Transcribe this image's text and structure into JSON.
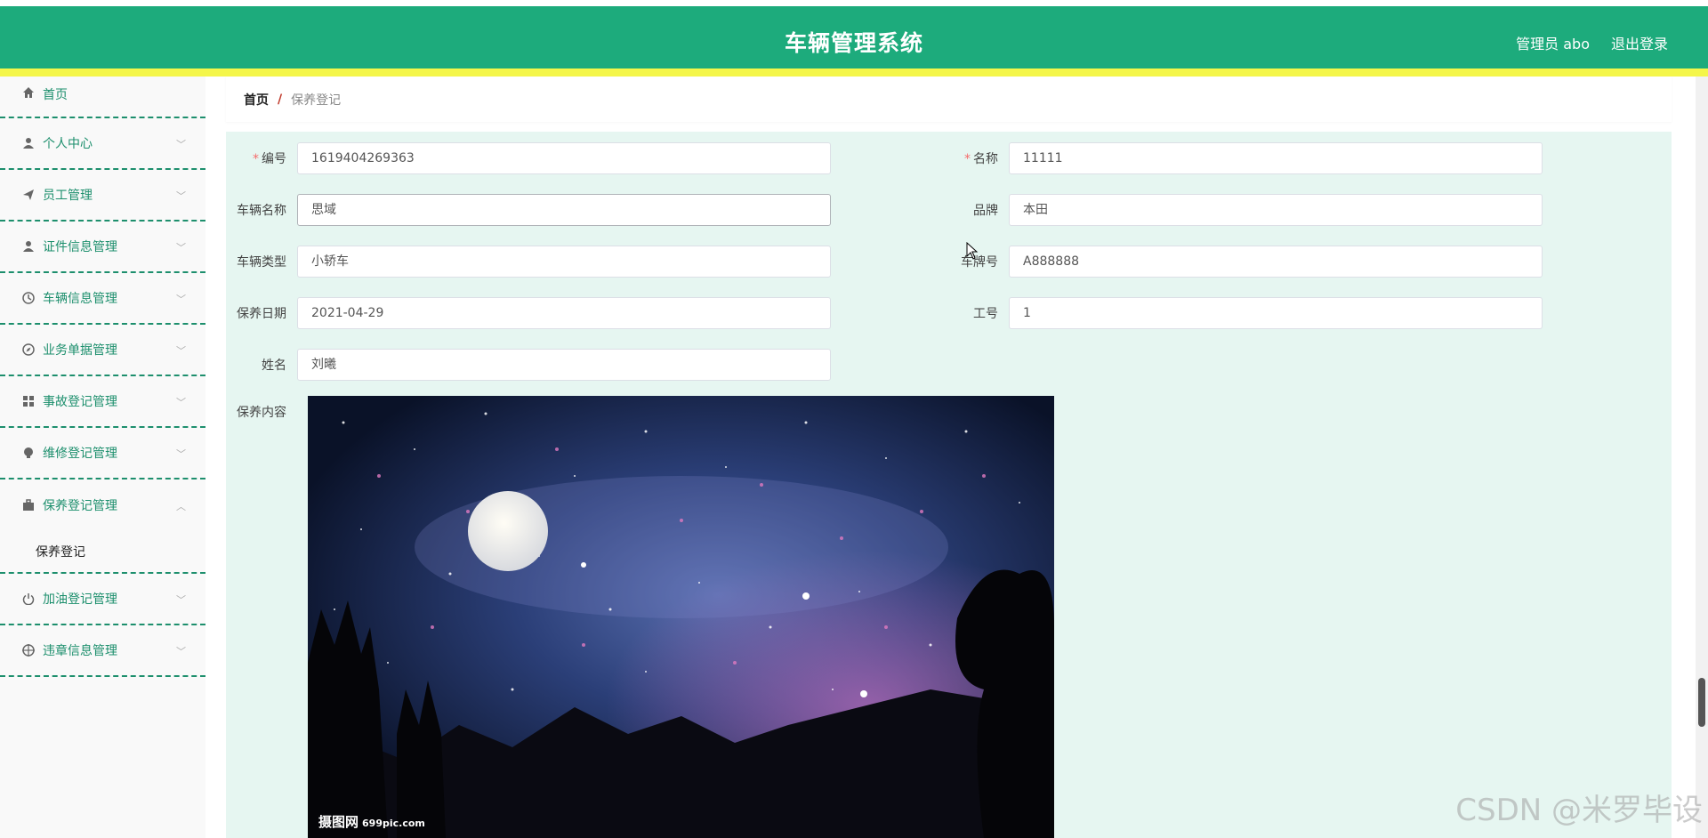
{
  "header": {
    "title": "车辆管理系统",
    "user": "管理员 abo",
    "logout": "退出登录"
  },
  "sidebar": {
    "items": [
      {
        "label": "首页",
        "icon": "home-icon"
      },
      {
        "label": "个人中心",
        "icon": "user-icon"
      },
      {
        "label": "员工管理",
        "icon": "send-icon"
      },
      {
        "label": "证件信息管理",
        "icon": "user-icon"
      },
      {
        "label": "车辆信息管理",
        "icon": "clock-icon"
      },
      {
        "label": "业务单据管理",
        "icon": "compass-icon"
      },
      {
        "label": "事故登记管理",
        "icon": "grid-icon"
      },
      {
        "label": "维修登记管理",
        "icon": "bulb-icon"
      },
      {
        "label": "保养登记管理",
        "icon": "suitcase-icon",
        "expanded": true
      },
      {
        "label": "加油登记管理",
        "icon": "power-icon"
      },
      {
        "label": "违章信息管理",
        "icon": "target-icon"
      }
    ],
    "sub_item": "保养登记"
  },
  "breadcrumb": {
    "home": "首页",
    "sep": "/",
    "current": "保养登记"
  },
  "form": {
    "code_label": "编号",
    "code_value": "1619404269363",
    "name_label": "名称",
    "name_value": "11111",
    "vehicle_name_label": "车辆名称",
    "vehicle_name_value": "思域",
    "brand_label": "品牌",
    "brand_value": "本田",
    "vehicle_type_label": "车辆类型",
    "vehicle_type_value": "小轿车",
    "plate_label": "车牌号",
    "plate_value": "A888888",
    "date_label": "保养日期",
    "date_value": "2021-04-29",
    "job_label": "工号",
    "job_value": "1",
    "person_label": "姓名",
    "person_value": "刘曦",
    "content_label": "保养内容",
    "image_watermark": "摄图网",
    "image_watermark_url": "699pic.com"
  },
  "watermark": "CSDN @米罗毕设"
}
